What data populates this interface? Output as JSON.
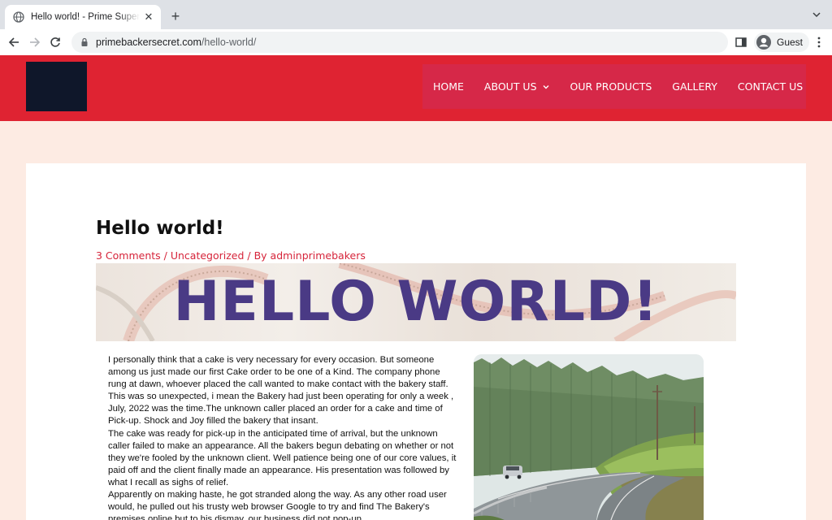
{
  "browser": {
    "tab_title": "Hello world! - Prime Supermarket",
    "url_host": "primebackersecret.com",
    "url_path": "/hello-world/",
    "profile_label": "Guest"
  },
  "site": {
    "nav": [
      {
        "label": "HOME"
      },
      {
        "label": "ABOUT US",
        "has_dropdown": true
      },
      {
        "label": "OUR PRODUCTS"
      },
      {
        "label": "GALLERY"
      },
      {
        "label": "CONTACT US"
      }
    ],
    "colors": {
      "header_bg": "#df2332",
      "nav_bg": "#d62848",
      "accent": "#d6243a",
      "page_bg": "#fdebe3"
    }
  },
  "post": {
    "title": "Hello world!",
    "meta": {
      "comments": "3 Comments",
      "sep1": " / ",
      "category": "Uncategorized",
      "sep2": " / By ",
      "author": "adminprimebakers"
    },
    "banner_text": "HELLO WORLD!",
    "paragraphs": [
      "I personally think that a cake is very necessary for every occasion. But someone among us just made our first Cake order to be one of a Kind. The company phone rung at dawn, whoever placed the call wanted to make contact with the bakery staff. This was so unexpected, i mean the Bakery had just been operating for only a week , July, 2022 was the time.The unknown caller placed an order for a cake and time of Pick-up. Shock and Joy filled the bakery that insant.",
      "The cake was ready for pick-up in the anticipated time of arrival, but the unknown caller failed to make an appearance. All the bakers begun debating on whether or not they we're fooled by the unknown client. Well patience being one of our core values, it paid off and the client finally made an appearance. His presentation was followed by what I recall as sighs of relief.",
      "Apparently on making haste, he got stranded along the way. As any other road user would, he pulled out his trusty web browser Google to try and find The Bakery's premises online but to his dismay, our business did not pop-up."
    ]
  }
}
